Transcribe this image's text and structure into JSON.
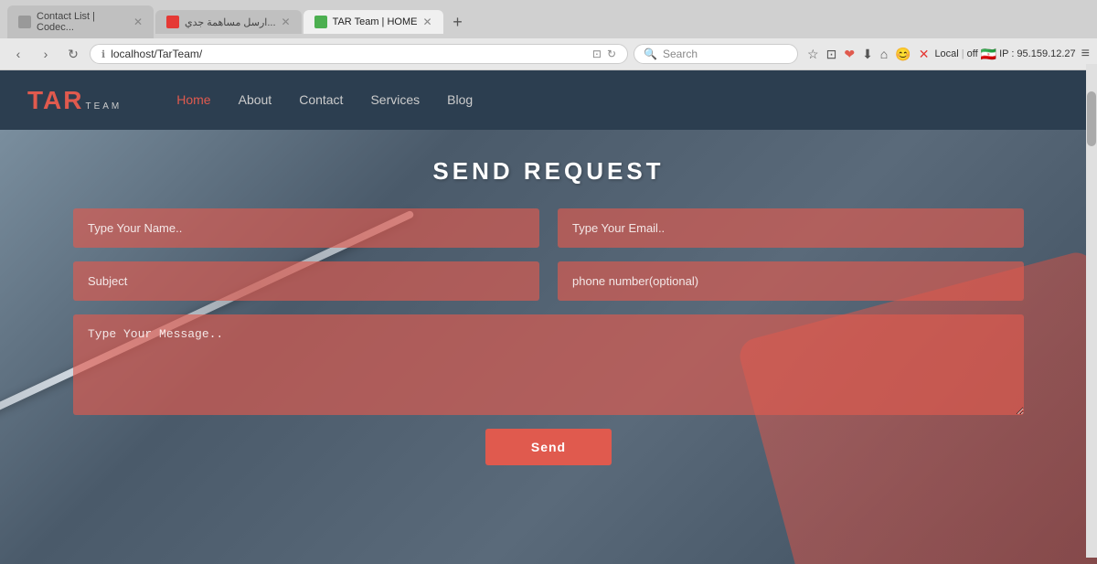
{
  "browser": {
    "tabs": [
      {
        "id": "tab1",
        "label": "Contact List | Codec...",
        "active": false,
        "favicon_color": "default"
      },
      {
        "id": "tab2",
        "label": "ارسل مساهمة جدي...",
        "active": false,
        "favicon_color": "red"
      },
      {
        "id": "tab3",
        "label": "TAR Team | HOME",
        "active": true,
        "favicon_color": "green"
      }
    ],
    "new_tab_label": "+",
    "nav": {
      "back": "‹",
      "forward": "›",
      "refresh": "↻"
    },
    "url": "localhost/TarTeam/",
    "url_icon": "ℹ",
    "search_placeholder": "Search",
    "icons": [
      "☆",
      "⊡",
      "❤",
      "⬇",
      "⌂",
      "😊",
      "✕"
    ],
    "local_label": "Local",
    "off_label": "off",
    "ip_label": "IP : 95.159.12.27",
    "menu_icon": "≡"
  },
  "navbar": {
    "logo_tar": "TAR",
    "logo_team": "TEAM",
    "links": [
      {
        "label": "Home",
        "active": true
      },
      {
        "label": "About",
        "active": false
      },
      {
        "label": "Contact",
        "active": false
      },
      {
        "label": "Services",
        "active": false
      },
      {
        "label": "Blog",
        "active": false
      }
    ]
  },
  "contact_form": {
    "title": "SEND REQUEST",
    "name_placeholder": "Type Your Name..",
    "email_placeholder": "Type Your Email..",
    "subject_placeholder": "Subject",
    "phone_placeholder": "phone number(optional)",
    "message_placeholder": "Type Your Message..",
    "send_button": "Send"
  }
}
